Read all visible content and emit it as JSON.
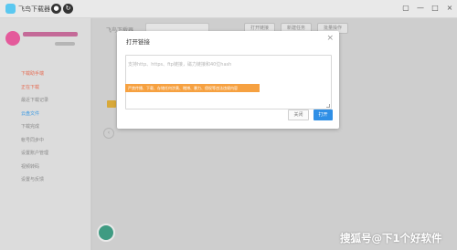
{
  "app": {
    "title": "飞鸟下载器",
    "logo_color": "#5bc8f0"
  },
  "window_controls": {
    "minimize": "—",
    "maximize": "□",
    "close": "×"
  },
  "sidebar": {
    "items": [
      {
        "label": "下载助手端"
      },
      {
        "label": "正在下载"
      },
      {
        "label": "最近下载记录"
      },
      {
        "label": "云盘文件"
      },
      {
        "label": "下载完成"
      },
      {
        "label": "帐号同步中"
      },
      {
        "label": "设置账户管理"
      },
      {
        "label": "视频转码"
      },
      {
        "label": "设置与反馈"
      }
    ]
  },
  "main": {
    "tab_label": "飞鸟下载器",
    "toolbar_buttons": [
      {
        "label": "打开链接"
      },
      {
        "label": "新建任务"
      },
      {
        "label": "批量操作"
      }
    ]
  },
  "dialog": {
    "title": "打开链接",
    "close_glyph": "×",
    "input_placeholder": "支持http、https、ftp链接，磁力链接和40位hash",
    "notice": "严禁传播、下载、存储任何涉黄、赌博、暴力、侵权等违法违规内容",
    "notice_color": "#f6a141",
    "cancel_label": "关闭",
    "open_label": "打开",
    "open_color": "#2f8fe6"
  },
  "watermark": "搜狐号@下1个好软件"
}
